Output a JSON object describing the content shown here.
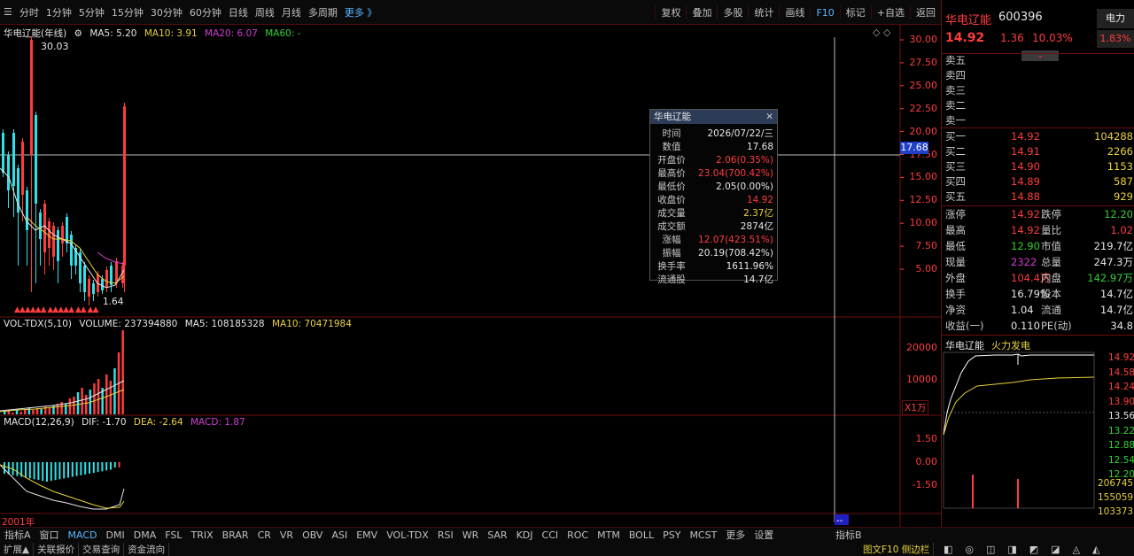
{
  "toolbar": {
    "items": [
      "分时",
      "1分钟",
      "5分钟",
      "15分钟",
      "30分钟",
      "60分钟",
      "日线",
      "周线",
      "月线",
      "多周期",
      "更多 》"
    ],
    "right_items": [
      "复权",
      "叠加",
      "多股",
      "统计",
      "画线",
      "F10",
      "标记",
      "+自选",
      "返回"
    ],
    "active_right": "F10"
  },
  "main_chart": {
    "title": "华电辽能(年线)",
    "ma5": "MA5: 5.20",
    "ma10": "MA10: 3.91",
    "ma20": "MA20: 6.07",
    "ma60": "MA60: -",
    "high_label": "30.03",
    "low_label": "1.64",
    "crosshair_value": "17.68",
    "y_ticks": [
      "30.00",
      "27.50",
      "25.00",
      "22.50",
      "20.00",
      "17.50",
      "15.00",
      "12.50",
      "10.00",
      "7.50",
      "5.00"
    ],
    "year_label": "2001年"
  },
  "volume_chart": {
    "title": "VOL-TDX(5,10)",
    "volume": "VOLUME: 237394880",
    "ma5": "MA5: 108185328",
    "ma10": "MA10: 70471984",
    "y_ticks": [
      "20000",
      "10000"
    ],
    "unit": "X1万"
  },
  "macd_chart": {
    "title": "MACD(12,26,9)",
    "dif": "DIF: -1.70",
    "dea": "DEA: -2.64",
    "macd": "MACD: 1.87",
    "y_ticks": [
      "1.50",
      "0.00",
      "-1.50"
    ]
  },
  "tooltip": {
    "header": "华电辽能",
    "rows": [
      {
        "k": "时间",
        "v": "2026/07/22/三",
        "c": "white"
      },
      {
        "k": "数值",
        "v": "17.68",
        "c": "white"
      },
      {
        "k": "开盘价",
        "v": "2.06(0.35%)",
        "c": "red"
      },
      {
        "k": "最高价",
        "v": "23.04(700.42%)",
        "c": "red"
      },
      {
        "k": "最低价",
        "v": "2.05(0.00%)",
        "c": "white"
      },
      {
        "k": "收盘价",
        "v": "14.92",
        "c": "red"
      },
      {
        "k": "成交量",
        "v": "2.37亿",
        "c": "yellow"
      },
      {
        "k": "成交额",
        "v": "2874亿",
        "c": "white"
      },
      {
        "k": "涨幅",
        "v": "12.07(423.51%)",
        "c": "red"
      },
      {
        "k": "振幅",
        "v": "20.19(708.42%)",
        "c": "white"
      },
      {
        "k": "换手率",
        "v": "1611.96%",
        "c": "white"
      },
      {
        "k": "流通股",
        "v": "14.7亿",
        "c": "white"
      }
    ]
  },
  "quote": {
    "name": "华电辽能",
    "code": "600396",
    "sector": "电力",
    "price": "14.92",
    "change": "1.36",
    "pct": "10.03%",
    "sector_pct": "1.83%",
    "asks": [
      "卖五",
      "卖四",
      "卖三",
      "卖二",
      "卖一"
    ],
    "bids": [
      {
        "k": "买一",
        "p": "14.92",
        "q": "104288"
      },
      {
        "k": "买二",
        "p": "14.91",
        "q": "2266"
      },
      {
        "k": "买三",
        "p": "14.90",
        "q": "1153"
      },
      {
        "k": "买四",
        "p": "14.89",
        "q": "587"
      },
      {
        "k": "买五",
        "p": "14.88",
        "q": "929"
      }
    ],
    "stats": [
      {
        "k": "涨停",
        "v": "14.92",
        "vc": "red",
        "k2": "跌停",
        "v2": "12.20",
        "v2c": "green"
      },
      {
        "k": "最高",
        "v": "14.92",
        "vc": "red",
        "k2": "量比",
        "v2": "1.02",
        "v2c": "red"
      },
      {
        "k": "最低",
        "v": "12.90",
        "vc": "green",
        "k2": "市值",
        "v2": "219.7亿",
        "v2c": "white"
      },
      {
        "k": "现量",
        "v": "2322",
        "vc": "purple",
        "k2": "总量",
        "v2": "247.3万",
        "v2c": "white"
      },
      {
        "k": "外盘",
        "v": "104.4万",
        "vc": "red",
        "k2": "内盘",
        "v2": "142.97万",
        "v2c": "green"
      },
      {
        "k": "换手",
        "v": "16.79%",
        "vc": "white",
        "k2": "股本",
        "v2": "14.7亿",
        "v2c": "white"
      },
      {
        "k": "净资",
        "v": "1.04",
        "vc": "white",
        "k2": "流通",
        "v2": "14.7亿",
        "v2c": "white"
      },
      {
        "k": "收益(一)",
        "v": "0.110",
        "vc": "white",
        "k2": "PE(动)",
        "v2": "34.8",
        "v2c": "white"
      }
    ],
    "mini_title": "华电辽能",
    "mini_tag": "火力发电",
    "mini_ticks": [
      "14.92",
      "14.58",
      "14.24",
      "13.90",
      "13.56",
      "13.22",
      "12.88",
      "12.54",
      "12.20"
    ],
    "mini_vol_ticks": [
      "206745",
      "155059",
      "103373"
    ]
  },
  "tabs": {
    "items": [
      "指标A",
      "窗口",
      "MACD",
      "DMI",
      "DMA",
      "FSL",
      "TRIX",
      "BRAR",
      "CR",
      "VR",
      "OBV",
      "ASI",
      "EMV",
      "VOL-TDX",
      "RSI",
      "WR",
      "SAR",
      "KDJ",
      "CCI",
      "ROC",
      "MTM",
      "BOLL",
      "PSY",
      "MCST",
      "更多",
      "设置"
    ],
    "active": "MACD",
    "right": "指标B"
  },
  "status": {
    "items": [
      "扩展▲",
      "关联报价",
      "交易查询",
      "资金流向"
    ],
    "right": "图文F10 侧边栏"
  },
  "colors": {
    "up": "#ff3c3c",
    "down": "#33d133",
    "ma5": "#e6e6e6",
    "ma10": "#e8d13a",
    "ma20": "#d23cd2",
    "ma60": "#33d133",
    "cyan": "#30e0e8"
  }
}
